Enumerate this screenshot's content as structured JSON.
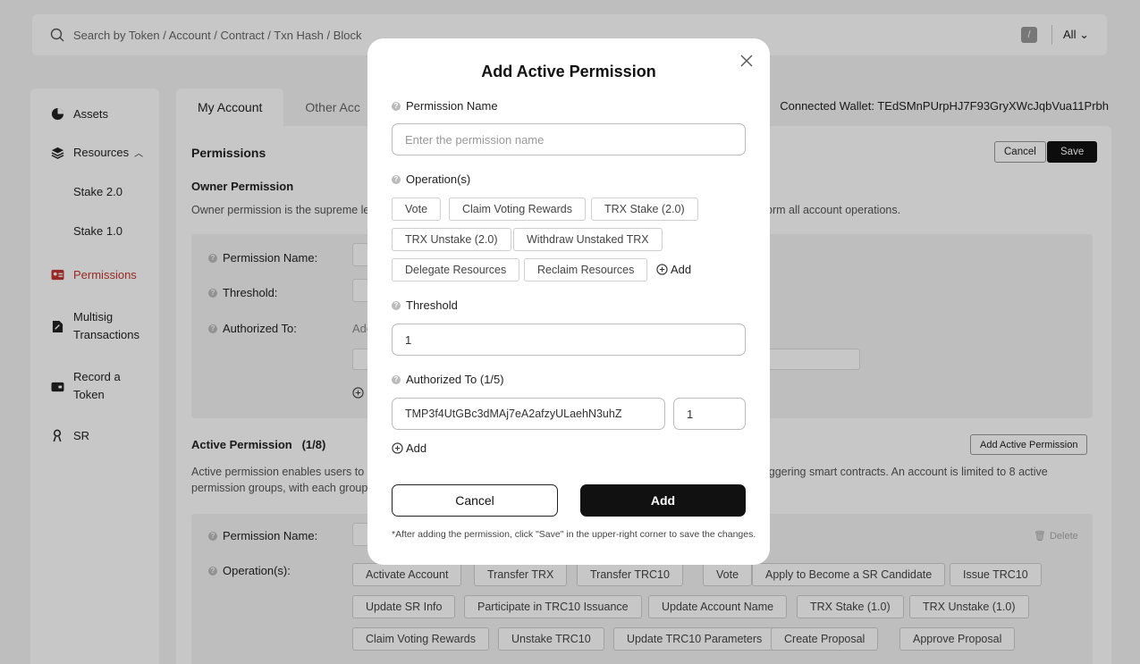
{
  "search": {
    "placeholder": "Search by Token / Account / Contract / Txn Hash / Block",
    "shortcut": "/",
    "filter": "All"
  },
  "sidebar": {
    "items": [
      {
        "label": "Assets",
        "icon": "pie-chart-icon"
      },
      {
        "label": "Resources",
        "icon": "layers-icon"
      },
      {
        "label": "Stake 2.0"
      },
      {
        "label": "Stake 1.0"
      },
      {
        "label": "Permissions",
        "icon": "id-card-icon"
      },
      {
        "label": "Multisig",
        "label2": "Transactions",
        "icon": "document-edit-icon"
      },
      {
        "label": "Record a",
        "label2": "Token",
        "icon": "wallet-icon"
      },
      {
        "label": "SR",
        "icon": "user-badge-icon"
      }
    ]
  },
  "tabs": {
    "my_account": "My Account",
    "other_account": "Other Acc"
  },
  "wallet": "Connected Wallet: TEdSMnPUrpHJ7F93GryXWcJqbVua11Prbh",
  "permissions": {
    "title": "Permissions",
    "cancel": "Cancel",
    "save": "Save",
    "owner": {
      "title": "Owner Permission",
      "desc_left": "Owner permission is the supreme le",
      "desc_right": "orm all account operations.",
      "name_label": "Permission Name:",
      "threshold_label": "Threshold:",
      "authorized_label": "Authorized To:",
      "authorized_hint": "Add"
    },
    "active": {
      "title": "Active Permission",
      "count": "(1/8)",
      "add_button": "Add Active Permission",
      "desc_l1": "Active permission enables users to c",
      "desc_r1": "iggering smart contracts. An account is limited to 8 active",
      "desc_l2": "permission groups, with each group",
      "name_label": "Permission Name:",
      "operations_label": "Operation(s):",
      "delete": "Delete",
      "operations": [
        "Activate Account",
        "Transfer TRX",
        "Transfer TRC10",
        "Vote",
        "Apply to Become a SR Candidate",
        "Issue TRC10",
        "Update SR Info",
        "Participate in TRC10 Issuance",
        "Update Account Name",
        "TRX Stake (1.0)",
        "TRX Unstake (1.0)",
        "Claim Voting Rewards",
        "Unstake TRC10",
        "Update TRC10 Parameters",
        "Create Proposal",
        "Approve Proposal"
      ]
    }
  },
  "modal": {
    "title": "Add Active Permission",
    "permission_name_label": "Permission Name",
    "permission_name_placeholder": "Enter the permission name",
    "operations_label": "Operation(s)",
    "operations": [
      "Vote",
      "Claim Voting Rewards",
      "TRX Stake (2.0)",
      "TRX Unstake (2.0)",
      "Withdraw Unstaked TRX",
      "Delegate Resources",
      "Reclaim Resources"
    ],
    "add_op": "Add",
    "threshold_label": "Threshold",
    "threshold_value": "1",
    "authorized_label": "Authorized To (1/5)",
    "authorized_address": "TMP3f4UtGBc3dMAj7eA2afzyULaehN3uhZ",
    "authorized_weight": "1",
    "add_auth": "Add",
    "cancel": "Cancel",
    "add": "Add",
    "note": "*After adding the permission, click \"Save\" in the upper-right corner to save the changes."
  }
}
